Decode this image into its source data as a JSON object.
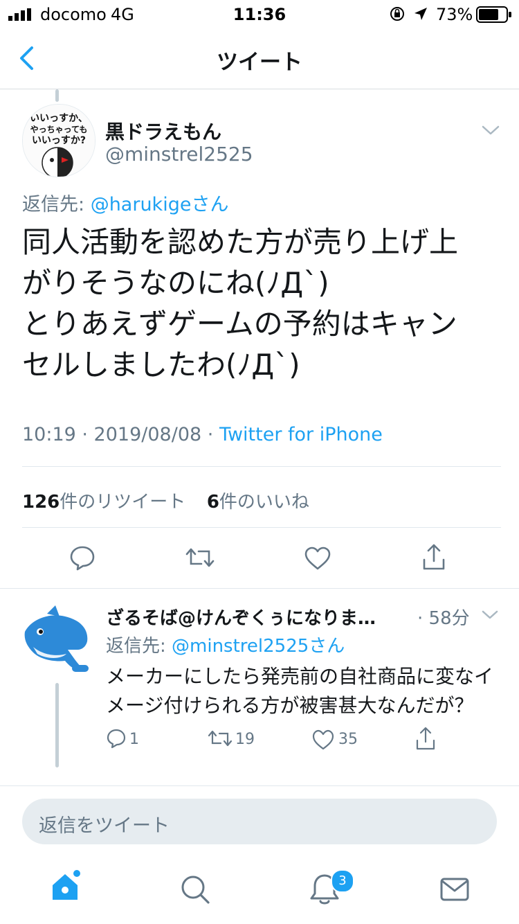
{
  "status_bar": {
    "carrier": "docomo",
    "network": "4G",
    "time": "11:36",
    "battery_percent": "73%",
    "battery_level": 0.73,
    "icons": [
      "signal-icon",
      "orientation-lock-icon",
      "location-icon",
      "battery-icon"
    ]
  },
  "nav": {
    "back_icon": "chevron-left-icon",
    "title": "ツイート"
  },
  "tweet": {
    "display_name": "黒ドラえもん",
    "handle": "@minstrel2525",
    "avatar_text": [
      "いいっすか、",
      "やっちゃっても",
      "いいっすか?"
    ],
    "reply_to_prefix": "返信先: ",
    "reply_to_user": "@harukigeさん",
    "text": "同人活動を認めた方が売り上げ上\nがりそうなのにね(ﾉДˋ)\nとりあえずゲームの予約はキャン\nセルしましたわ(ﾉДˋ)",
    "timestamp": "10:19 · 2019/08/08 · ",
    "source": "Twitter for iPhone",
    "retweet_count": "126",
    "retweet_label": "件のリツイート",
    "like_count": "6",
    "like_label": "件のいいね"
  },
  "reply": {
    "display_name": "ざるそば@けんぞくぅになりま…",
    "time": "· 58分",
    "reply_to_prefix": "返信先: ",
    "reply_to_user": "@minstrel2525さん",
    "text": "メーカーにしたら発売前の自社商品に変なイ\nメージ付けられる方が被害甚大なんだが？",
    "reply_count": "1",
    "retweet_count": "19",
    "like_count": "35"
  },
  "composer": {
    "placeholder": "返信をツイート"
  },
  "tab_bar": {
    "items": [
      "home-icon",
      "search-icon",
      "notifications-icon",
      "messages-icon"
    ],
    "notification_badge": "3"
  },
  "colors": {
    "accent": "#1da1f2",
    "secondary_text": "#657786",
    "primary_text": "#14171a",
    "divider": "#e1e8ed"
  }
}
